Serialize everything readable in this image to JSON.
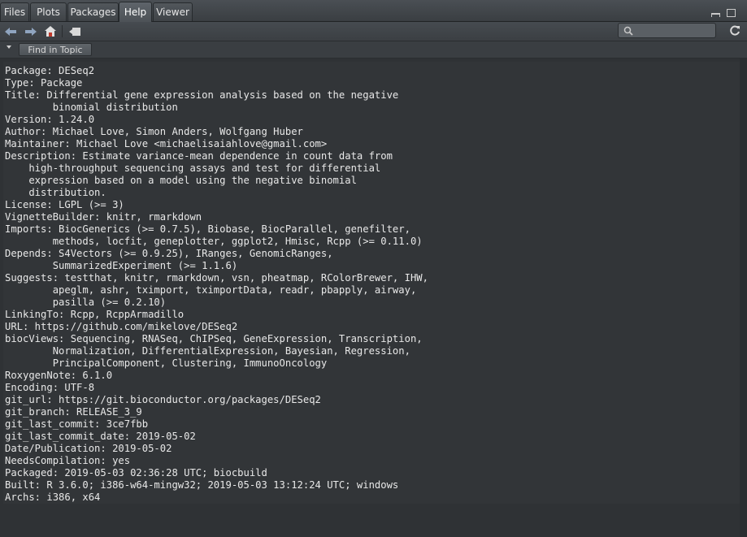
{
  "tabs": [
    "Files",
    "Plots",
    "Packages",
    "Help",
    "Viewer"
  ],
  "active_tab": "Help",
  "toolbar": {
    "find_in_topic": "Find in Topic",
    "search_placeholder": ""
  },
  "description_lines": [
    "Package: DESeq2",
    "Type: Package",
    "Title: Differential gene expression analysis based on the negative",
    "        binomial distribution",
    "Version: 1.24.0",
    "Author: Michael Love, Simon Anders, Wolfgang Huber",
    "Maintainer: Michael Love <michaelisaiahlove@gmail.com>",
    "Description: Estimate variance-mean dependence in count data from",
    "    high-throughput sequencing assays and test for differential",
    "    expression based on a model using the negative binomial",
    "    distribution.",
    "License: LGPL (>= 3)",
    "VignetteBuilder: knitr, rmarkdown",
    "Imports: BiocGenerics (>= 0.7.5), Biobase, BiocParallel, genefilter,",
    "        methods, locfit, geneplotter, ggplot2, Hmisc, Rcpp (>= 0.11.0)",
    "Depends: S4Vectors (>= 0.9.25), IRanges, GenomicRanges,",
    "        SummarizedExperiment (>= 1.1.6)",
    "Suggests: testthat, knitr, rmarkdown, vsn, pheatmap, RColorBrewer, IHW,",
    "        apeglm, ashr, tximport, tximportData, readr, pbapply, airway,",
    "        pasilla (>= 0.2.10)",
    "LinkingTo: Rcpp, RcppArmadillo",
    "URL: https://github.com/mikelove/DESeq2",
    "biocViews: Sequencing, RNASeq, ChIPSeq, GeneExpression, Transcription,",
    "        Normalization, DifferentialExpression, Bayesian, Regression,",
    "        PrincipalComponent, Clustering, ImmunoOncology",
    "RoxygenNote: 6.1.0",
    "Encoding: UTF-8",
    "git_url: https://git.bioconductor.org/packages/DESeq2",
    "git_branch: RELEASE_3_9",
    "git_last_commit: 3ce7fbb",
    "git_last_commit_date: 2019-05-02",
    "Date/Publication: 2019-05-02",
    "NeedsCompilation: yes",
    "Packaged: 2019-05-03 02:36:28 UTC; biocbuild",
    "Built: R 3.6.0; i386-w64-mingw32; 2019-05-03 13:12:24 UTC; windows",
    "Archs: i386, x64"
  ]
}
